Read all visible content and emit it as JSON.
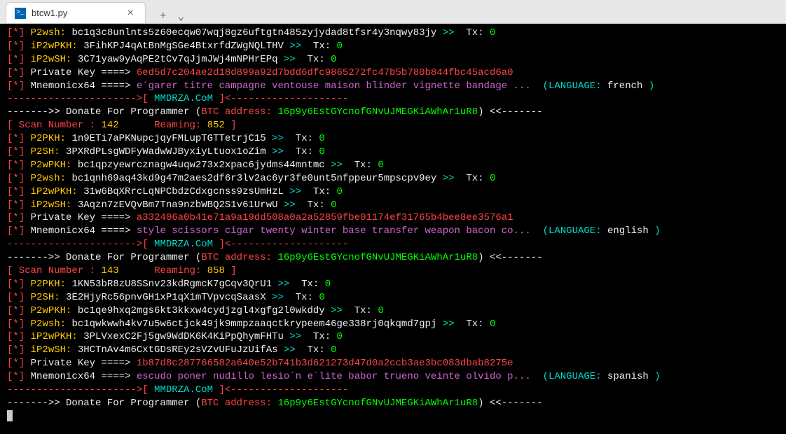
{
  "tab": {
    "title": "btcw1.py",
    "icon_char": ">_"
  },
  "blocks": [
    {
      "addresses": [
        {
          "type": "P2wsh",
          "addr": "bc1q3c8unlnts5z60ecqw07wqj8gz6uftgtn485zyjydad8tfsr4y3nqwy83jy",
          "tx": "0"
        },
        {
          "type": "iP2wPKH",
          "addr": "3FihKPJ4qAtBnMgSGe4BtxrfdZWgNQLTHV",
          "tx": "0"
        },
        {
          "type": "iP2wSH",
          "addr": "3C71yaw9yAqPE2tCv7qJjmJWj4mNPHrEPq",
          "tx": "0"
        }
      ],
      "pk": "6ed5d7c204ae2d18d899a92d7bdd6dfc9865272fc47b5b780b844fbc45acd6a0",
      "mnemonic": "e´garer titre campagne ventouse maison blinder vignette bandage ...",
      "lang": "french",
      "btc": "16p9y6EstGYcnofGNvUJMEGKiAWhAr1uR8"
    },
    {
      "scan": "142",
      "ream": "852",
      "addresses": [
        {
          "type": "P2PKH",
          "addr": "1n9ETi7aPKNupcjqyFMLupTGTTetrjC15",
          "tx": "0"
        },
        {
          "type": "P2SH",
          "addr": "3PXRdPLsgWDFyWadwWJByxiyLtuox1oZim",
          "tx": "0"
        },
        {
          "type": "P2wPKH",
          "addr": "bc1qpzyewrcznagw4uqw273x2xpac6jydms44mntmc",
          "tx": "0"
        },
        {
          "type": "P2wsh",
          "addr": "bc1qnh69aq43kd9g47m2aes2df6r3lv2ac6yr3fe0unt5nfppeur5mpscpv9ey",
          "tx": "0"
        },
        {
          "type": "iP2wPKH",
          "addr": "31w6BqXRrcLqNPCbdzCdxgcnss9zsUmHzL",
          "tx": "0"
        },
        {
          "type": "iP2wSH",
          "addr": "3Aqzn7zEVQvBm7Tna9nzbWBQ2S1v61UrwU",
          "tx": "0"
        }
      ],
      "pk": "a332406a0b41e71a9a19dd508a0a2a52859fbe01174ef31765b4bee8ee3576a1",
      "mnemonic": "style scissors cigar twenty winter base transfer weapon bacon co...",
      "lang": "english",
      "btc": "16p9y6EstGYcnofGNvUJMEGKiAWhAr1uR8"
    },
    {
      "scan": "143",
      "ream": "858",
      "addresses": [
        {
          "type": "P2PKH",
          "addr": "1KN53bR8zU8SSnv23kdRgmcK7gCqv3QrU1",
          "tx": "0"
        },
        {
          "type": "P2SH",
          "addr": "3E2HjyRc56pnvGH1xP1qX1mTVpvcqSaasX",
          "tx": "0"
        },
        {
          "type": "P2wPKH",
          "addr": "bc1qe9hxq2mgs6kt3kkxw4cydjzgl4xgfg2l0wkddy",
          "tx": "0"
        },
        {
          "type": "P2wsh",
          "addr": "bc1qwkwwh4kv7u5w6ctjck49jk9mmpzaaqctkrypeem46ge338rj0qkqmd7gpj",
          "tx": "0"
        },
        {
          "type": "iP2wPKH",
          "addr": "3PLVxexC2Fj5gw9WdDK6K4KiPpQhymFHTu",
          "tx": "0"
        },
        {
          "type": "iP2wSH",
          "addr": "3HCTnAv4m6CxtGDsREy2sVZvUFuJzUifAs",
          "tx": "0"
        }
      ],
      "pk": "1b87d8c287766582a640e52b741b3d621273d47d0a2ccb3ae3bc083dbab8275e",
      "mnemonic": "escudo poner nudillo lesio´n e´lite babor trueno veinte olvido p...",
      "lang": "spanish",
      "btc": "16p9y6EstGYcnofGNvUJMEGKiAWhAr1uR8"
    }
  ],
  "static": {
    "star": "[*]",
    "pk_label": "Private Key ====> ",
    "mn_label": "Mnemonicx64 ====> ",
    "lang_open": "(LANGUAGE: ",
    "lang_close": " )",
    "sep_lead": "---------------------->[ ",
    "sep_mid": "MMDRZA.CoM",
    "sep_tail": " ]<--------------------",
    "donate_pre": "------->> Donate For Programmer (",
    "btc_label": "BTC address: ",
    "donate_post": ") <<-------",
    "scan_open": "[ Scan Number : ",
    "ream_label": "Reaming: ",
    "scan_close": " ]",
    "arrow": " >>  ",
    "tx_label": "Tx: "
  }
}
